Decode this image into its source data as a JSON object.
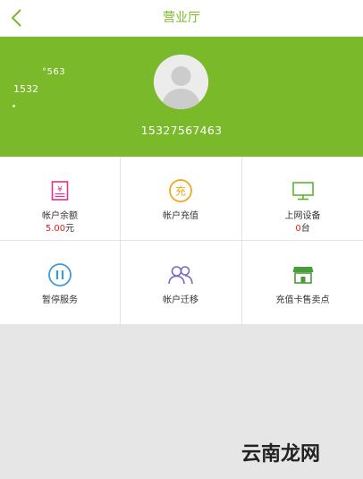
{
  "nav": {
    "title": "营业厅"
  },
  "header": {
    "tiny_text": "°563",
    "short_text": "1532",
    "phone": "15327567463"
  },
  "services": [
    {
      "label": "帐户余额",
      "value": "5.00",
      "unit": "元",
      "icon": "balance-icon",
      "color": "#e0338b"
    },
    {
      "label": "帐户充值",
      "value": "",
      "unit": "",
      "icon": "recharge-icon",
      "color": "#f2a516"
    },
    {
      "label": "上网设备",
      "value": "0",
      "unit": "台",
      "icon": "monitor-icon",
      "color": "#5cb531"
    },
    {
      "label": "暂停服务",
      "value": "",
      "unit": "",
      "icon": "pause-icon",
      "color": "#3d9bd8"
    },
    {
      "label": "帐户迁移",
      "value": "",
      "unit": "",
      "icon": "users-icon",
      "color": "#7b68c4"
    },
    {
      "label": "充值卡售卖点",
      "value": "",
      "unit": "",
      "icon": "store-icon",
      "color": "#4a9b3a"
    }
  ],
  "colors": {
    "accent": "#7ab929",
    "value_red": "#e02020"
  },
  "watermark": "云南龙网"
}
